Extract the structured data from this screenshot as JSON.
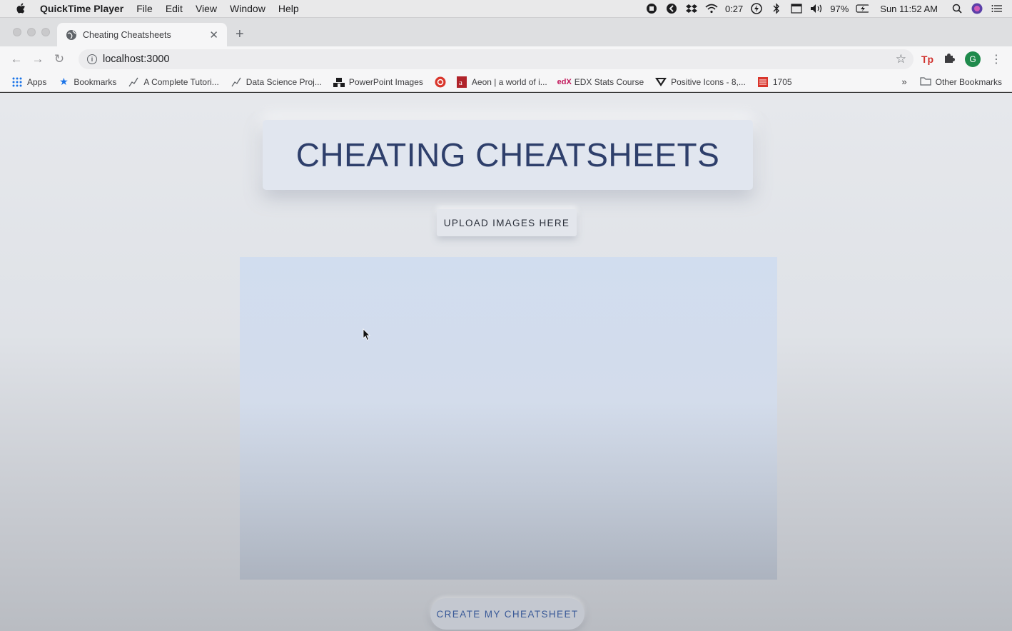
{
  "menubar": {
    "app_name": "QuickTime Player",
    "items": [
      "File",
      "Edit",
      "View",
      "Window",
      "Help"
    ],
    "timer": "0:27",
    "battery": "97%",
    "clock": "Sun 11:52 AM"
  },
  "browser": {
    "tab_title": "Cheating Cheatsheets",
    "url": "localhost:3000",
    "profile_initial": "G"
  },
  "bookmarks": {
    "items": [
      {
        "label": "Apps",
        "icon": "apps-grid-icon"
      },
      {
        "label": "Bookmarks",
        "icon": "star-icon"
      },
      {
        "label": "A Complete Tutori...",
        "icon": "chart-line-icon"
      },
      {
        "label": "Data Science Proj...",
        "icon": "chart-line-icon"
      },
      {
        "label": "PowerPoint Images",
        "icon": "slide-icon"
      },
      {
        "label": "",
        "icon": "red-circle-icon"
      },
      {
        "label": "Aeon | a world of i...",
        "icon": "aeon-icon"
      },
      {
        "label": "EDX Stats Course",
        "icon": "edx-icon"
      },
      {
        "label": "Positive Icons - 8,...",
        "icon": "v-logo-icon"
      },
      {
        "label": "1705",
        "icon": "red-bookmark-icon"
      }
    ],
    "more": "»",
    "other": "Other Bookmarks"
  },
  "page": {
    "title": "CHEATING CHEATSHEETS",
    "upload_button": "UPLOAD IMAGES HERE",
    "create_button": "CREATE MY CHEATSHEET"
  }
}
